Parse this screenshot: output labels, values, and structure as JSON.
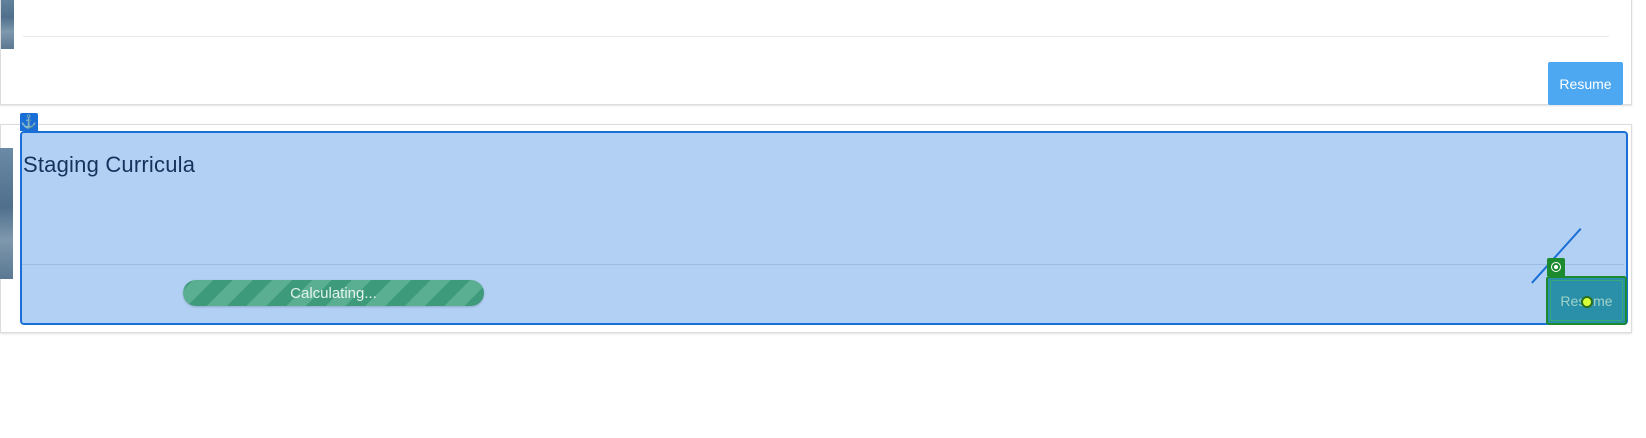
{
  "cards": [
    {
      "title": "",
      "resume_label": "Resume"
    },
    {
      "title": "Staging Curricula",
      "progress_label": "Calculating...",
      "resume_label": "Resume"
    }
  ],
  "overlay": {
    "anchor_icon": "anchor-icon",
    "target_icon": "target-icon",
    "highlight_color": "#1a6fd6",
    "target_color": "#1c8a2e"
  },
  "colors": {
    "resume_button": "#4ea7f1",
    "progress_bar": "#3d9b7c",
    "title_text": "#16325c"
  }
}
